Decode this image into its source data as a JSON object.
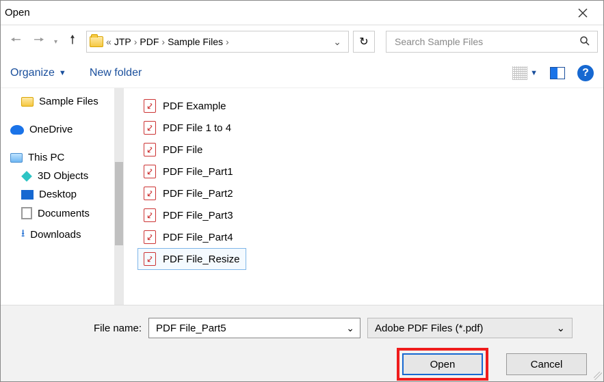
{
  "title": "Open",
  "breadcrumb": {
    "b0": "JTP",
    "b1": "PDF",
    "b2": "Sample Files"
  },
  "search": {
    "placeholder": "Search Sample Files"
  },
  "toolbar": {
    "organize": "Organize",
    "new_folder": "New folder"
  },
  "sidebar": {
    "sample_files": "Sample Files",
    "onedrive": "OneDrive",
    "this_pc": "This PC",
    "objects3d": "3D Objects",
    "desktop": "Desktop",
    "documents": "Documents",
    "downloads": "Downloads"
  },
  "files": {
    "f0": "PDF Example",
    "f1": "PDF File 1 to 4",
    "f2": "PDF File",
    "f3": "PDF File_Part1",
    "f4": "PDF File_Part2",
    "f5": "PDF File_Part3",
    "f6": "PDF File_Part4",
    "f7": "PDF File_Resize"
  },
  "filename_label": "File name:",
  "filename_value": "PDF File_Part5",
  "filetype_value": "Adobe PDF Files (*.pdf)",
  "buttons": {
    "open": "Open",
    "cancel": "Cancel"
  }
}
